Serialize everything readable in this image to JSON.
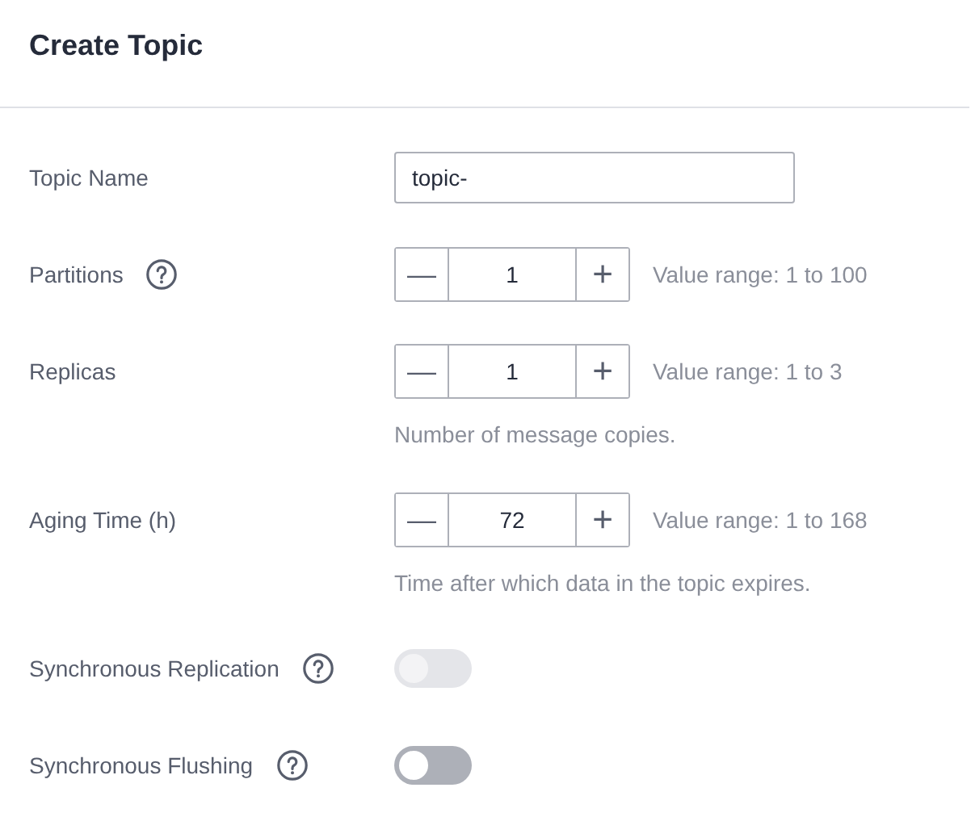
{
  "title": "Create Topic",
  "fields": [
    {
      "kind": "text",
      "label": "Topic Name",
      "help": false,
      "value": "topic-"
    },
    {
      "kind": "stepper",
      "label": "Partitions",
      "help": true,
      "minus": "—",
      "plus": "+",
      "value": "1",
      "range": "Value range: 1 to 100"
    },
    {
      "kind": "stepper",
      "label": "Replicas",
      "help": false,
      "minus": "—",
      "plus": "+",
      "value": "1",
      "range": "Value range: 1 to 3",
      "hint": "Number of message copies."
    },
    {
      "kind": "stepper",
      "label": "Aging Time (h)",
      "help": false,
      "minus": "—",
      "plus": "+",
      "value": "72",
      "range": "Value range: 1 to 168",
      "hint": "Time after which data in the topic expires."
    },
    {
      "kind": "switch",
      "label": "Synchronous Replication",
      "help": true,
      "on": false,
      "disabled": true
    },
    {
      "kind": "switch",
      "label": "Synchronous Flushing",
      "help": true,
      "on": false,
      "disabled": false
    }
  ]
}
